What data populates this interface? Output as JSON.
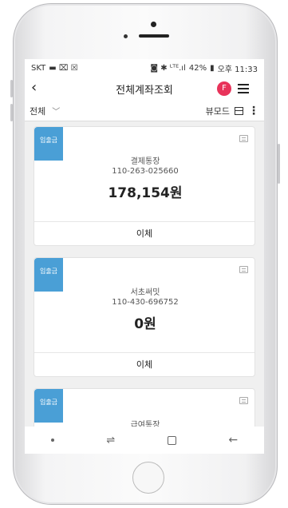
{
  "status": {
    "carrier": "SKT",
    "left_icons": "▬ ⌧ ☒",
    "right_icons": "◙ ✱ ᴸᵀᴱ.ıl",
    "battery": "42%",
    "battery_icon": "▮",
    "time": "오후 11:33"
  },
  "nav": {
    "back_icon": "‹",
    "title": "전체계좌조회",
    "profile_badge": "F"
  },
  "filter": {
    "selected": "전체",
    "view_mode": "뷰모드",
    "more": "⋮"
  },
  "accounts": [
    {
      "tag": "입출금",
      "name": "결제통장",
      "number": "110-263-025660",
      "balance": "178,154원",
      "action": "이체"
    },
    {
      "tag": "입출금",
      "name": "서초써밋",
      "number": "110-430-696752",
      "balance": "0원",
      "action": "이체"
    },
    {
      "tag": "입출금",
      "name": "급여통장"
    }
  ],
  "system_nav": {
    "recent_icon": "⇌",
    "back_icon": "←"
  },
  "colors": {
    "tag_blue": "#4a9fd6",
    "badge_red": "#e8335a"
  }
}
